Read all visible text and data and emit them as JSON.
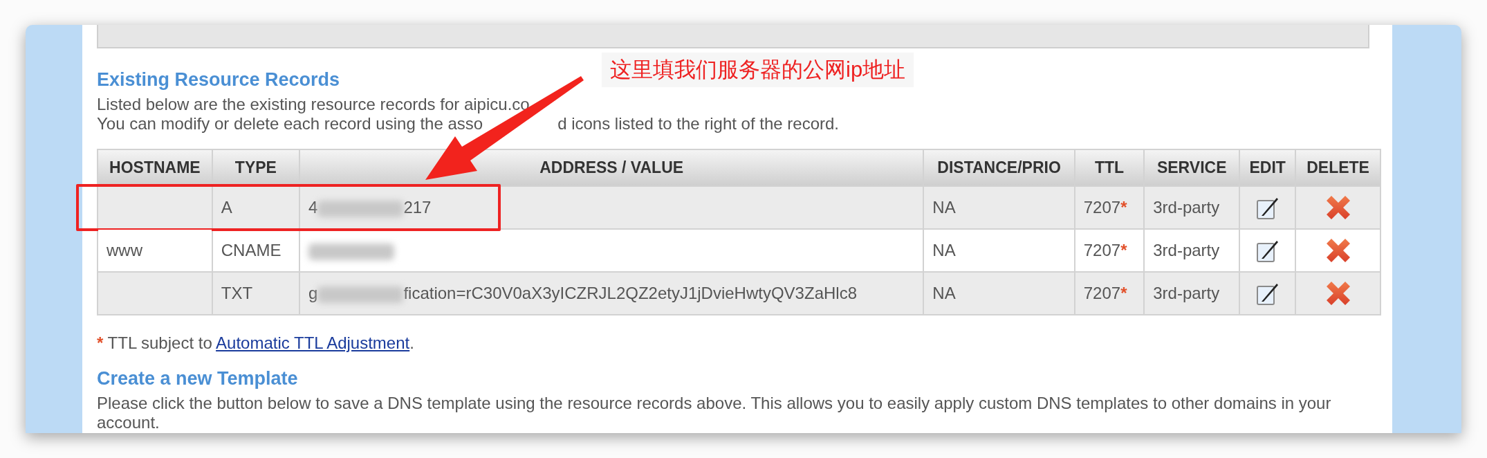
{
  "annotation": {
    "callout": "这里填我们服务器的公网ip地址"
  },
  "records_section": {
    "title": "Existing Resource Records",
    "intro_line_1": "Listed below are the existing resource records for aipicu.co",
    "intro_line_2_start": "You can modify or delete each record using the asso",
    "intro_line_2_end": "d icons listed to the right of the record."
  },
  "table": {
    "columns": [
      "HOSTNAME",
      "TYPE",
      "ADDRESS / VALUE",
      "DISTANCE/PRIO",
      "TTL",
      "SERVICE",
      "EDIT",
      "DELETE"
    ],
    "rows": [
      {
        "hostname": "",
        "type": "A",
        "address": {
          "visible_prefix": "4",
          "visible_suffix": "217",
          "blurred": true
        },
        "distance": "NA",
        "ttl": "7207",
        "ttl_mark": "*",
        "service": "3rd-party",
        "highlighted": true
      },
      {
        "hostname": "www",
        "type": "CNAME",
        "address": {
          "blurred": true
        },
        "distance": "NA",
        "ttl": "7207",
        "ttl_mark": "*",
        "service": "3rd-party",
        "highlighted": false
      },
      {
        "hostname": "",
        "type": "TXT",
        "address": {
          "visible_prefix": "g",
          "visible_suffix": "fication=rC30V0aX3yICZRJL2QZ2etyJ1jDvieHwtyQV3ZaHlc8",
          "blurred": true
        },
        "distance": "NA",
        "ttl": "7207",
        "ttl_mark": "*",
        "service": "3rd-party",
        "highlighted": false
      }
    ]
  },
  "footnote": {
    "mark": "*",
    "text": "TTL subject to ",
    "link": "Automatic TTL Adjustment",
    "end": "."
  },
  "template_section": {
    "title": "Create a new Template",
    "text": "Please click the button below to save a DNS template using the resource records above. This allows you to easily apply custom DNS templates to other domains in your account."
  }
}
